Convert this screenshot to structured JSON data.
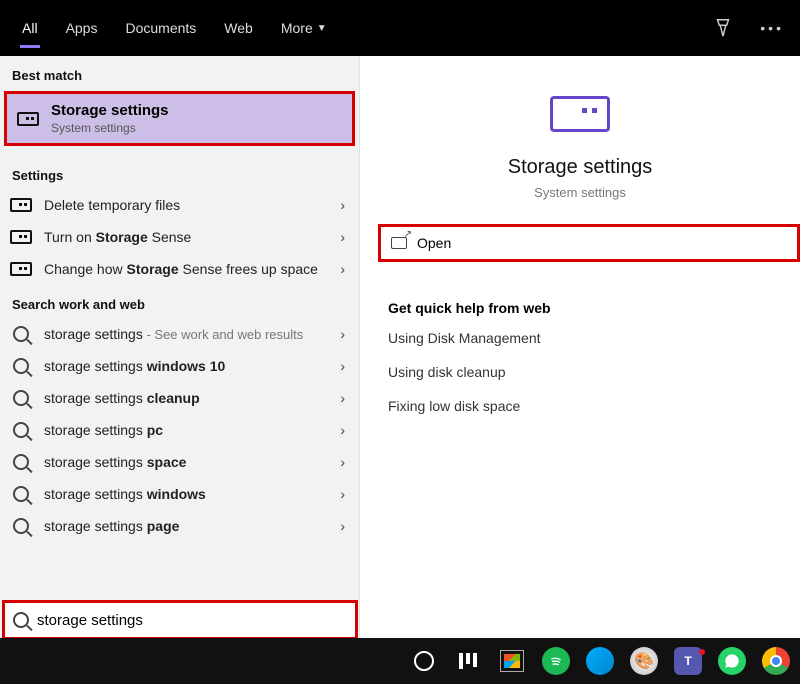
{
  "topbar": {
    "tabs": [
      "All",
      "Apps",
      "Documents",
      "Web",
      "More"
    ],
    "active": 0
  },
  "left": {
    "bestMatchLabel": "Best match",
    "bestMatch": {
      "title": "Storage settings",
      "subtitle": "System settings"
    },
    "settingsLabel": "Settings",
    "settingsItems": [
      {
        "text": "Delete temporary files"
      },
      {
        "prefix": "Turn on ",
        "bold": "Storage",
        "suffix": " Sense"
      },
      {
        "prefix": "Change how ",
        "bold": "Storage",
        "suffix": " Sense frees up space"
      }
    ],
    "searchLabel": "Search work and web",
    "searchItems": [
      {
        "plain": "storage settings",
        "trail": " - See work and web results"
      },
      {
        "pre": "storage settings ",
        "bold": "windows 10"
      },
      {
        "pre": "storage settings ",
        "bold": "cleanup"
      },
      {
        "pre": "storage settings ",
        "bold": "pc"
      },
      {
        "pre": "storage settings ",
        "bold": "space"
      },
      {
        "pre": "storage settings ",
        "bold": "windows"
      },
      {
        "pre": "storage settings ",
        "bold": "page"
      }
    ]
  },
  "right": {
    "title": "Storage settings",
    "subtitle": "System settings",
    "openLabel": "Open",
    "helpHeader": "Get quick help from web",
    "helpLinks": [
      "Using Disk Management",
      "Using disk cleanup",
      "Fixing low disk space"
    ]
  },
  "search": {
    "value": "storage settings"
  }
}
